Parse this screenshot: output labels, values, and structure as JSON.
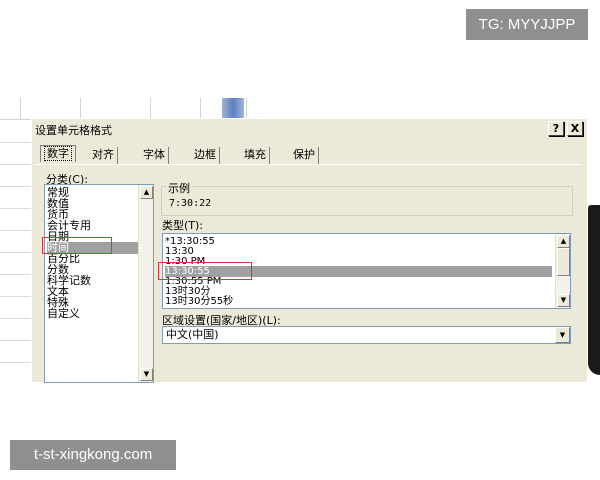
{
  "watermarks": {
    "top": "TG: MYYJJPP",
    "bottom": "t-st-xingkong.com"
  },
  "dialog": {
    "title": "设置单元格格式",
    "help_button": "?",
    "close_button": "X"
  },
  "tabs": [
    {
      "label": "数字",
      "active": true
    },
    {
      "label": "对齐"
    },
    {
      "label": "字体"
    },
    {
      "label": "边框"
    },
    {
      "label": "填充"
    },
    {
      "label": "保护"
    }
  ],
  "category": {
    "label": "分类(C):",
    "items": [
      "常规",
      "数值",
      "货币",
      "会计专用",
      "日期",
      "时间",
      "百分比",
      "分数",
      "科学记数",
      "文本",
      "特殊",
      "自定义"
    ],
    "selected": "时间"
  },
  "sample": {
    "label": "示例",
    "value": "7:30:22"
  },
  "type": {
    "label": "类型(T):",
    "items": [
      "*13:30:55",
      "13:30",
      "1:30 PM",
      "13:30:55",
      "1:30:55 PM",
      "13时30分",
      "13时30分55秒"
    ],
    "selected": "13:30:55"
  },
  "locale": {
    "label": "区域设置(国家/地区)(L):",
    "value": "中文(中国)"
  },
  "icons": {
    "scroll_up": "scroll-up-arrow",
    "scroll_down": "scroll-down-arrow",
    "dropdown": "dropdown-arrow"
  },
  "colors": {
    "highlight": "#d03a3a",
    "selection": "#a0a0a0",
    "dialog_bg": "#ece9d8"
  }
}
